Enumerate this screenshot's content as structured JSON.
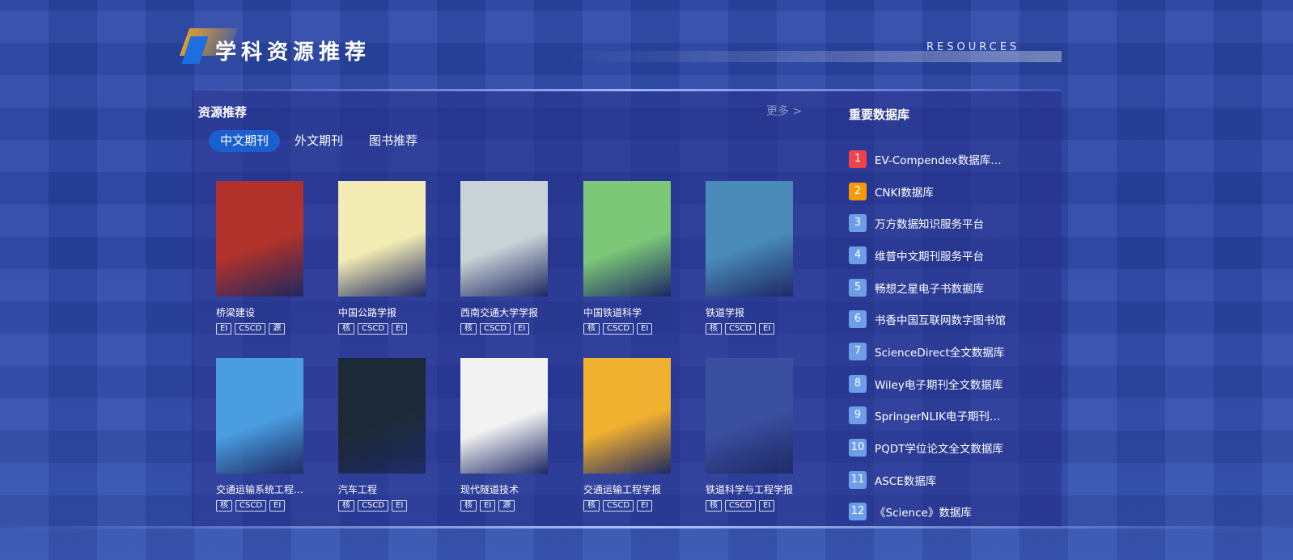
{
  "header": {
    "title": "学科资源推荐",
    "subtitle": "RESOURCES"
  },
  "resources": {
    "title": "资源推荐",
    "more": "更多 >",
    "tabs": [
      {
        "label": "中文期刊"
      },
      {
        "label": "外文期刊"
      },
      {
        "label": "图书推荐"
      }
    ],
    "books": [
      {
        "name": "桥梁建设",
        "tags": [
          "EI",
          "CSCD",
          "源"
        ],
        "cover": "#b0322a"
      },
      {
        "name": "中国公路学报",
        "tags": [
          "核",
          "CSCD",
          "EI"
        ],
        "cover": "#f3ecb4"
      },
      {
        "name": "西南交通大学学报",
        "tags": [
          "核",
          "CSCD",
          "EI"
        ],
        "cover": "#c9d2d6"
      },
      {
        "name": "中国铁道科学",
        "tags": [
          "核",
          "CSCD",
          "EI"
        ],
        "cover": "#7cc878"
      },
      {
        "name": "铁道学报",
        "tags": [
          "核",
          "CSCD",
          "EI"
        ],
        "cover": "#4a8ab8"
      },
      {
        "name": "交通运输系统工程与信息",
        "tags": [
          "核",
          "CSCD",
          "EI"
        ],
        "cover": "#4a9ee0"
      },
      {
        "name": "汽车工程",
        "tags": [
          "核",
          "CSCD",
          "EI"
        ],
        "cover": "#1c2a38"
      },
      {
        "name": "现代隧道技术",
        "tags": [
          "核",
          "EI",
          "源"
        ],
        "cover": "#f2f2f2"
      },
      {
        "name": "交通运输工程学报",
        "tags": [
          "核",
          "CSCD",
          "EI"
        ],
        "cover": "#f0b030"
      },
      {
        "name": "铁道科学与工程学报",
        "tags": [
          "核",
          "CSCD",
          "EI"
        ],
        "cover": "#3b4fa0"
      }
    ]
  },
  "databases": {
    "title": "重要数据库",
    "items": [
      {
        "num": "1",
        "name": "EV-Compendex数据库（美国工程索引）",
        "color": "#f0424a"
      },
      {
        "num": "2",
        "name": "CNKI数据库",
        "color": "#f59a0a"
      },
      {
        "num": "3",
        "name": "万方数据知识服务平台"
      },
      {
        "num": "4",
        "name": "维普中文期刊服务平台"
      },
      {
        "num": "5",
        "name": "畅想之星电子书数据库"
      },
      {
        "num": "6",
        "name": "书香中国互联网数字图书馆"
      },
      {
        "num": "7",
        "name": "ScienceDirect全文数据库"
      },
      {
        "num": "8",
        "name": "Wiley电子期刊全文数据库"
      },
      {
        "num": "9",
        "name": "SpringerNLIK电子期刊全文数据库"
      },
      {
        "num": "10",
        "name": "PQDT学位论文全文数据库"
      },
      {
        "num": "11",
        "name": "ASCE数据库"
      },
      {
        "num": "12",
        "name": "《Science》数据库"
      }
    ]
  }
}
